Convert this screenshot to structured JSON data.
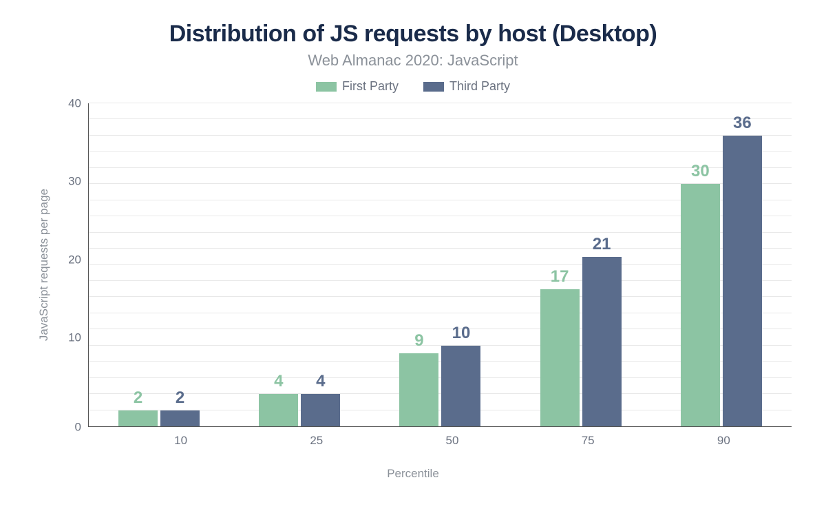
{
  "chart_data": {
    "type": "bar",
    "title": "Distribution of JS requests by host (Desktop)",
    "subtitle": "Web Almanac 2020: JavaScript",
    "xlabel": "Percentile",
    "ylabel": "JavaScript requests per page",
    "categories": [
      "10",
      "25",
      "50",
      "75",
      "90"
    ],
    "series": [
      {
        "name": "First Party",
        "color": "#8cc4a3",
        "values": [
          2,
          4,
          9,
          17,
          30
        ]
      },
      {
        "name": "Third Party",
        "color": "#5a6c8c",
        "values": [
          2,
          4,
          10,
          21,
          36
        ]
      }
    ],
    "ylim": [
      0,
      40
    ],
    "yticks": [
      0,
      10,
      20,
      30,
      40
    ],
    "legend_position": "top"
  }
}
